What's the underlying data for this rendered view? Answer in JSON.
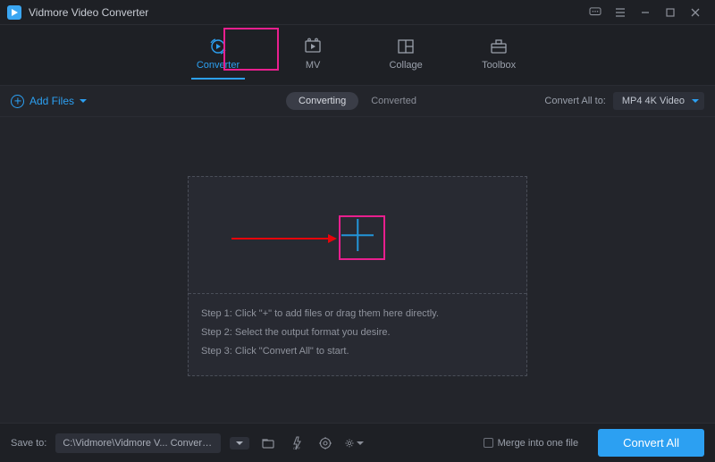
{
  "app": {
    "title": "Vidmore Video Converter"
  },
  "nav": {
    "items": [
      {
        "label": "Converter"
      },
      {
        "label": "MV"
      },
      {
        "label": "Collage"
      },
      {
        "label": "Toolbox"
      }
    ]
  },
  "toolbar": {
    "add_files": "Add Files",
    "sub_tabs": {
      "converting": "Converting",
      "converted": "Converted"
    },
    "convert_all_to_label": "Convert All to:",
    "format_selected": "MP4 4K Video"
  },
  "dropzone": {
    "steps": [
      "Step 1: Click \"+\" to add files or drag them here directly.",
      "Step 2: Select the output format you desire.",
      "Step 3: Click \"Convert All\" to start."
    ]
  },
  "bottom": {
    "save_to_label": "Save to:",
    "output_path": "C:\\Vidmore\\Vidmore V... Converter\\Converted",
    "merge_label": "Merge into one file",
    "convert_all_button": "Convert All"
  }
}
